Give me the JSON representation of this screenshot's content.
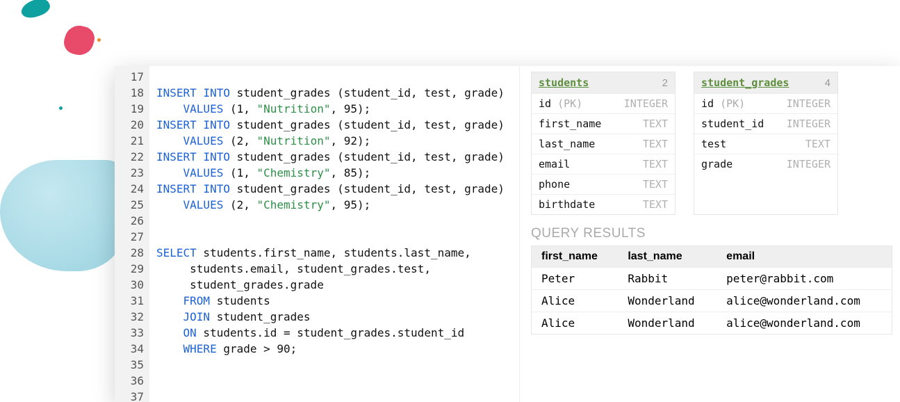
{
  "editor": {
    "first_line_no": 17,
    "lines": [
      [],
      [
        {
          "t": "kw",
          "v": "INSERT"
        },
        {
          "t": "",
          "v": " "
        },
        {
          "t": "kw",
          "v": "INTO"
        },
        {
          "t": "",
          "v": " student_grades (student_id, test, grade)"
        }
      ],
      [
        {
          "t": "",
          "v": "    "
        },
        {
          "t": "kw",
          "v": "VALUES"
        },
        {
          "t": "",
          "v": " ("
        },
        {
          "t": "num",
          "v": "1"
        },
        {
          "t": "",
          "v": ", "
        },
        {
          "t": "str",
          "v": "\"Nutrition\""
        },
        {
          "t": "",
          "v": ", "
        },
        {
          "t": "num",
          "v": "95"
        },
        {
          "t": "",
          "v": ");"
        }
      ],
      [
        {
          "t": "kw",
          "v": "INSERT"
        },
        {
          "t": "",
          "v": " "
        },
        {
          "t": "kw",
          "v": "INTO"
        },
        {
          "t": "",
          "v": " student_grades (student_id, test, grade)"
        }
      ],
      [
        {
          "t": "",
          "v": "    "
        },
        {
          "t": "kw",
          "v": "VALUES"
        },
        {
          "t": "",
          "v": " ("
        },
        {
          "t": "num",
          "v": "2"
        },
        {
          "t": "",
          "v": ", "
        },
        {
          "t": "str",
          "v": "\"Nutrition\""
        },
        {
          "t": "",
          "v": ", "
        },
        {
          "t": "num",
          "v": "92"
        },
        {
          "t": "",
          "v": ");"
        }
      ],
      [
        {
          "t": "kw",
          "v": "INSERT"
        },
        {
          "t": "",
          "v": " "
        },
        {
          "t": "kw",
          "v": "INTO"
        },
        {
          "t": "",
          "v": " student_grades (student_id, test, grade)"
        }
      ],
      [
        {
          "t": "",
          "v": "    "
        },
        {
          "t": "kw",
          "v": "VALUES"
        },
        {
          "t": "",
          "v": " ("
        },
        {
          "t": "num",
          "v": "1"
        },
        {
          "t": "",
          "v": ", "
        },
        {
          "t": "str",
          "v": "\"Chemistry\""
        },
        {
          "t": "",
          "v": ", "
        },
        {
          "t": "num",
          "v": "85"
        },
        {
          "t": "",
          "v": ");"
        }
      ],
      [
        {
          "t": "kw",
          "v": "INSERT"
        },
        {
          "t": "",
          "v": " "
        },
        {
          "t": "kw",
          "v": "INTO"
        },
        {
          "t": "",
          "v": " student_grades (student_id, test, grade)"
        }
      ],
      [
        {
          "t": "",
          "v": "    "
        },
        {
          "t": "kw",
          "v": "VALUES"
        },
        {
          "t": "",
          "v": " ("
        },
        {
          "t": "num",
          "v": "2"
        },
        {
          "t": "",
          "v": ", "
        },
        {
          "t": "str",
          "v": "\"Chemistry\""
        },
        {
          "t": "",
          "v": ", "
        },
        {
          "t": "num",
          "v": "95"
        },
        {
          "t": "",
          "v": ");"
        }
      ],
      [],
      [],
      [
        {
          "t": "kw",
          "v": "SELECT"
        },
        {
          "t": "",
          "v": " students.first_name, students.last_name,"
        }
      ],
      [
        {
          "t": "",
          "v": "     students.email, student_grades.test,"
        }
      ],
      [
        {
          "t": "",
          "v": "     student_grades.grade"
        }
      ],
      [
        {
          "t": "",
          "v": "    "
        },
        {
          "t": "kw",
          "v": "FROM"
        },
        {
          "t": "",
          "v": " students"
        }
      ],
      [
        {
          "t": "",
          "v": "    "
        },
        {
          "t": "kw",
          "v": "JOIN"
        },
        {
          "t": "",
          "v": " student_grades"
        }
      ],
      [
        {
          "t": "",
          "v": "    "
        },
        {
          "t": "kw",
          "v": "ON"
        },
        {
          "t": "",
          "v": " students.id = student_grades.student_id"
        }
      ],
      [
        {
          "t": "",
          "v": "    "
        },
        {
          "t": "kw",
          "v": "WHERE"
        },
        {
          "t": "",
          "v": " grade > "
        },
        {
          "t": "num",
          "v": "90"
        },
        {
          "t": "",
          "v": ";"
        }
      ],
      [],
      [],
      []
    ]
  },
  "schemas": [
    {
      "name": "students",
      "count": 2,
      "columns": [
        {
          "name": "id",
          "pk": true,
          "type": "INTEGER"
        },
        {
          "name": "first_name",
          "pk": false,
          "type": "TEXT"
        },
        {
          "name": "last_name",
          "pk": false,
          "type": "TEXT"
        },
        {
          "name": "email",
          "pk": false,
          "type": "TEXT"
        },
        {
          "name": "phone",
          "pk": false,
          "type": "TEXT"
        },
        {
          "name": "birthdate",
          "pk": false,
          "type": "TEXT"
        }
      ]
    },
    {
      "name": "student_grades",
      "count": 4,
      "columns": [
        {
          "name": "id",
          "pk": true,
          "type": "INTEGER"
        },
        {
          "name": "student_id",
          "pk": false,
          "type": "INTEGER"
        },
        {
          "name": "test",
          "pk": false,
          "type": "TEXT"
        },
        {
          "name": "grade",
          "pk": false,
          "type": "INTEGER"
        }
      ]
    }
  ],
  "results": {
    "title": "QUERY RESULTS",
    "headers": [
      "first_name",
      "last_name",
      "email"
    ],
    "rows": [
      [
        "Peter",
        "Rabbit",
        "peter@rabbit.com"
      ],
      [
        "Alice",
        "Wonderland",
        "alice@wonderland.com"
      ],
      [
        "Alice",
        "Wonderland",
        "alice@wonderland.com"
      ]
    ]
  }
}
